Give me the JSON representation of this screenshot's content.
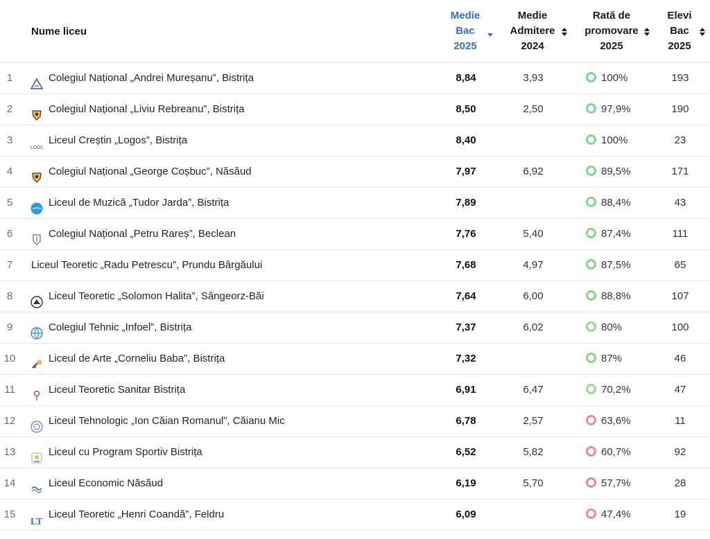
{
  "header": {
    "name_label": "Nume liceu",
    "bac_label": [
      "Medie",
      "Bac",
      "2025"
    ],
    "admitere_label": [
      "Medie",
      "Admitere",
      "2024"
    ],
    "rata_label": [
      "Rată de",
      "promovare",
      "2025"
    ],
    "elevi_label": [
      "Elevi",
      "Bac",
      "2025"
    ]
  },
  "colors": {
    "active_sort": "#2f6fe0",
    "rate_high": "#7ed88a",
    "rate_mid": "#9bd68a",
    "rate_low": "#f08a8a"
  },
  "rows": [
    {
      "idx": "1",
      "name": "Colegiul Național „Andrei Mureșanu”, Bistrița",
      "logo": "triangle-logo-icon",
      "bac": "8,84",
      "adm": "3,93",
      "rate": "100%",
      "rate_value": 1.0,
      "elevi": "193"
    },
    {
      "idx": "2",
      "name": "Colegiul Național „Liviu Rebreanu”, Bistrița",
      "logo": "crest-logo-icon",
      "bac": "8,50",
      "adm": "2,50",
      "rate": "97,9%",
      "rate_value": 0.979,
      "elevi": "190"
    },
    {
      "idx": "3",
      "name": "Liceul Creștin „Logos”, Bistrița",
      "logo": "logos-logo-icon",
      "bac": "8,40",
      "adm": "",
      "rate": "100%",
      "rate_value": 1.0,
      "elevi": "23"
    },
    {
      "idx": "4",
      "name": "Colegiul Național „George Coșbuc”, Năsăud",
      "logo": "crest-logo-icon",
      "bac": "7,97",
      "adm": "6,92",
      "rate": "89,5%",
      "rate_value": 0.895,
      "elevi": "171"
    },
    {
      "idx": "5",
      "name": "Liceul de Muzică „Tudor Jarda”, Bistrița",
      "logo": "blue-circle-logo-icon",
      "bac": "7,89",
      "adm": "",
      "rate": "88,4%",
      "rate_value": 0.884,
      "elevi": "43"
    },
    {
      "idx": "6",
      "name": "Colegiul Național „Petru Rareș”, Beclean",
      "logo": "shield-logo-icon",
      "bac": "7,76",
      "adm": "5,40",
      "rate": "87,4%",
      "rate_value": 0.874,
      "elevi": "111"
    },
    {
      "idx": "7",
      "name": "Liceul Teoretic „Radu Petrescu”, Prundu Bârgăului",
      "logo": "",
      "bac": "7,68",
      "adm": "4,97",
      "rate": "87,5%",
      "rate_value": 0.875,
      "elevi": "65"
    },
    {
      "idx": "8",
      "name": "Liceul Teoretic „Solomon Halita”, Sângeorz-Băi",
      "logo": "round-emblem-logo-icon",
      "bac": "7,64",
      "adm": "6,00",
      "rate": "88,8%",
      "rate_value": 0.888,
      "elevi": "107"
    },
    {
      "idx": "9",
      "name": "Colegiul Tehnic „Infoel”, Bistrița",
      "logo": "globe-logo-icon",
      "bac": "7,37",
      "adm": "6,02",
      "rate": "80%",
      "rate_value": 0.8,
      "elevi": "100"
    },
    {
      "idx": "10",
      "name": "Liceul de Arte „Corneliu Baba”, Bistrița",
      "logo": "palette-logo-icon",
      "bac": "7,32",
      "adm": "",
      "rate": "87%",
      "rate_value": 0.87,
      "elevi": "46"
    },
    {
      "idx": "11",
      "name": "Liceul Teoretic Sanitar Bistrița",
      "logo": "pin-logo-icon",
      "bac": "6,91",
      "adm": "6,47",
      "rate": "70,2%",
      "rate_value": 0.702,
      "elevi": "47"
    },
    {
      "idx": "12",
      "name": "Liceul Tehnologic „Ion Căian Romanul”, Căianu Mic",
      "logo": "circle-seal-logo-icon",
      "bac": "6,78",
      "adm": "2,57",
      "rate": "63,6%",
      "rate_value": 0.636,
      "elevi": "11"
    },
    {
      "idx": "13",
      "name": "Liceul cu Program Sportiv Bistrița",
      "logo": "sport-logo-icon",
      "bac": "6,52",
      "adm": "5,82",
      "rate": "60,7%",
      "rate_value": 0.607,
      "elevi": "92"
    },
    {
      "idx": "14",
      "name": "Liceul Economic Năsăud",
      "logo": "wave-logo-icon",
      "bac": "6,19",
      "adm": "5,70",
      "rate": "57,7%",
      "rate_value": 0.577,
      "elevi": "28"
    },
    {
      "idx": "15",
      "name": "Liceul Teoretic „Henri Coandă”, Feldru",
      "logo": "ltc-logo-icon",
      "bac": "6,09",
      "adm": "",
      "rate": "47,4%",
      "rate_value": 0.474,
      "elevi": "19"
    }
  ]
}
